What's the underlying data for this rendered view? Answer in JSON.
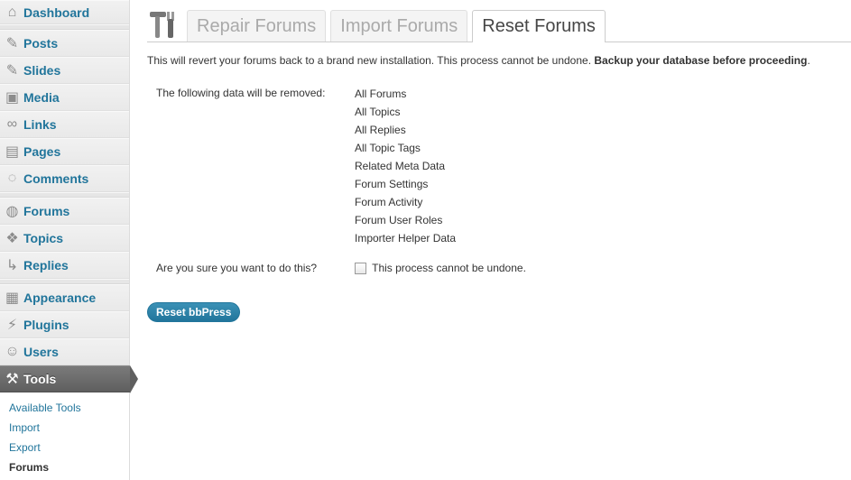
{
  "sidebar": {
    "items": [
      {
        "label": "Dashboard",
        "icon": "dashboard-icon"
      },
      {
        "label": "Posts",
        "icon": "pushpin-icon"
      },
      {
        "label": "Slides",
        "icon": "pushpin-icon"
      },
      {
        "label": "Media",
        "icon": "media-icon"
      },
      {
        "label": "Links",
        "icon": "link-icon"
      },
      {
        "label": "Pages",
        "icon": "pages-icon"
      },
      {
        "label": "Comments",
        "icon": "comment-icon"
      },
      {
        "label": "Forums",
        "icon": "forums-icon"
      },
      {
        "label": "Topics",
        "icon": "topics-icon"
      },
      {
        "label": "Replies",
        "icon": "replies-icon"
      },
      {
        "label": "Appearance",
        "icon": "appearance-icon"
      },
      {
        "label": "Plugins",
        "icon": "plugin-icon"
      },
      {
        "label": "Users",
        "icon": "users-icon"
      },
      {
        "label": "Tools",
        "icon": "tools-icon"
      }
    ],
    "tools_submenu": [
      "Available Tools",
      "Import",
      "Export",
      "Forums"
    ]
  },
  "tabs": [
    "Repair Forums",
    "Import Forums",
    "Reset Forums"
  ],
  "active_tab": "Reset Forums",
  "intro": {
    "text": "This will revert your forums back to a brand new installation. This process cannot be undone. ",
    "bold": "Backup your database before proceeding",
    "end": "."
  },
  "form": {
    "removed_label": "The following data will be removed:",
    "removed_items": [
      "All Forums",
      "All Topics",
      "All Replies",
      "All Topic Tags",
      "Related Meta Data",
      "Forum Settings",
      "Forum Activity",
      "Forum User Roles",
      "Importer Helper Data"
    ],
    "confirm_label": "Are you sure you want to do this?",
    "confirm_checkbox_label": "This process cannot be undone."
  },
  "reset_button": "Reset bbPress",
  "colors": {
    "link": "#21759b",
    "active_menu": "#6d6d6d",
    "button": "#21759b"
  }
}
